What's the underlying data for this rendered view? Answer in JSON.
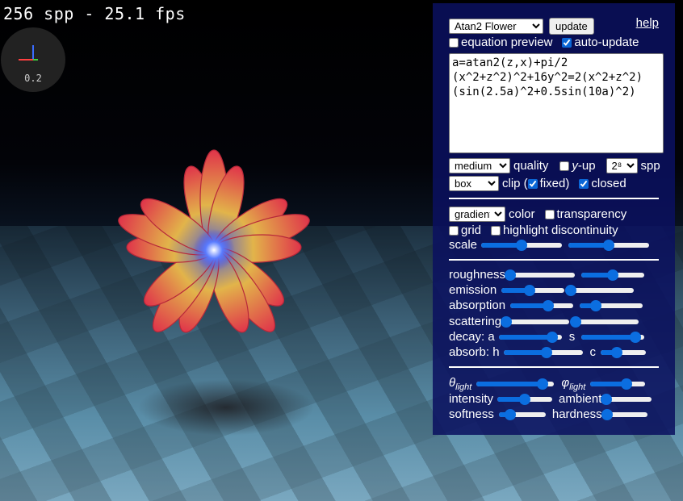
{
  "status": {
    "fps_text": "256 spp - 25.1 fps"
  },
  "axes": {
    "scale": "0.2"
  },
  "panel": {
    "preset": {
      "selected": "Atan2 Flower"
    },
    "update_label": "update",
    "help_label": "help",
    "equation_preview": {
      "label": "equation preview",
      "checked": false
    },
    "auto_update": {
      "label": "auto-update",
      "checked": true
    },
    "equation": "a=atan2(z,x)+pi/2\n(x^2+z^2)^2+16y^2=2(x^2+z^2)\n(sin(2.5a)^2+0.5sin(10a)^2)",
    "quality": {
      "selected": "medium",
      "label": "quality"
    },
    "y_up": {
      "label_italic": "y",
      "label_rest": "-up",
      "checked": false
    },
    "spp": {
      "selected": "2⁸",
      "label": "spp"
    },
    "clip": {
      "selected": "box",
      "label": "clip (",
      "fixed_label": "fixed)",
      "fixed_checked": true
    },
    "closed": {
      "label": "closed",
      "checked": true
    },
    "color": {
      "selected": "gradient",
      "label": "color"
    },
    "transparency": {
      "label": "transparency",
      "checked": false
    },
    "grid": {
      "label": "grid",
      "checked": false
    },
    "highlight_discontinuity": {
      "label": "highlight discontinuity",
      "checked": false
    },
    "scale": {
      "label": "scale",
      "values": [
        0.5,
        0.5
      ]
    },
    "roughness": {
      "label": "roughness",
      "values": [
        0.0,
        0.5
      ]
    },
    "emission": {
      "label": "emission",
      "values": [
        0.45,
        0.0
      ]
    },
    "absorption": {
      "label": "absorption",
      "values": [
        0.6,
        0.25
      ]
    },
    "scattering": {
      "label": "scattering",
      "values": [
        0.0,
        0.0
      ]
    },
    "decay_a": {
      "label": "decay: a",
      "values": [
        0.85
      ]
    },
    "decay_s": {
      "label": "s",
      "values": [
        0.85
      ]
    },
    "absorb_h": {
      "label": "absorb: h",
      "values": [
        0.55
      ]
    },
    "absorb_c": {
      "label": "c",
      "values": [
        0.35
      ]
    },
    "theta_light": {
      "label_main": "θ",
      "label_sub": "light",
      "values": [
        0.85
      ]
    },
    "phi_light": {
      "label_main": "φ",
      "label_sub": "light",
      "values": [
        0.65
      ]
    },
    "intensity": {
      "label": "intensity",
      "values": [
        0.5
      ]
    },
    "ambient": {
      "label": "ambient",
      "values": [
        0.0
      ]
    },
    "softness": {
      "label": "softness",
      "values": [
        0.25
      ]
    },
    "hardness": {
      "label": "hardness",
      "values": [
        0.0
      ]
    }
  },
  "colors": {
    "panel_bg": "#0a1060",
    "slider_accent": "#0b6ee0"
  }
}
